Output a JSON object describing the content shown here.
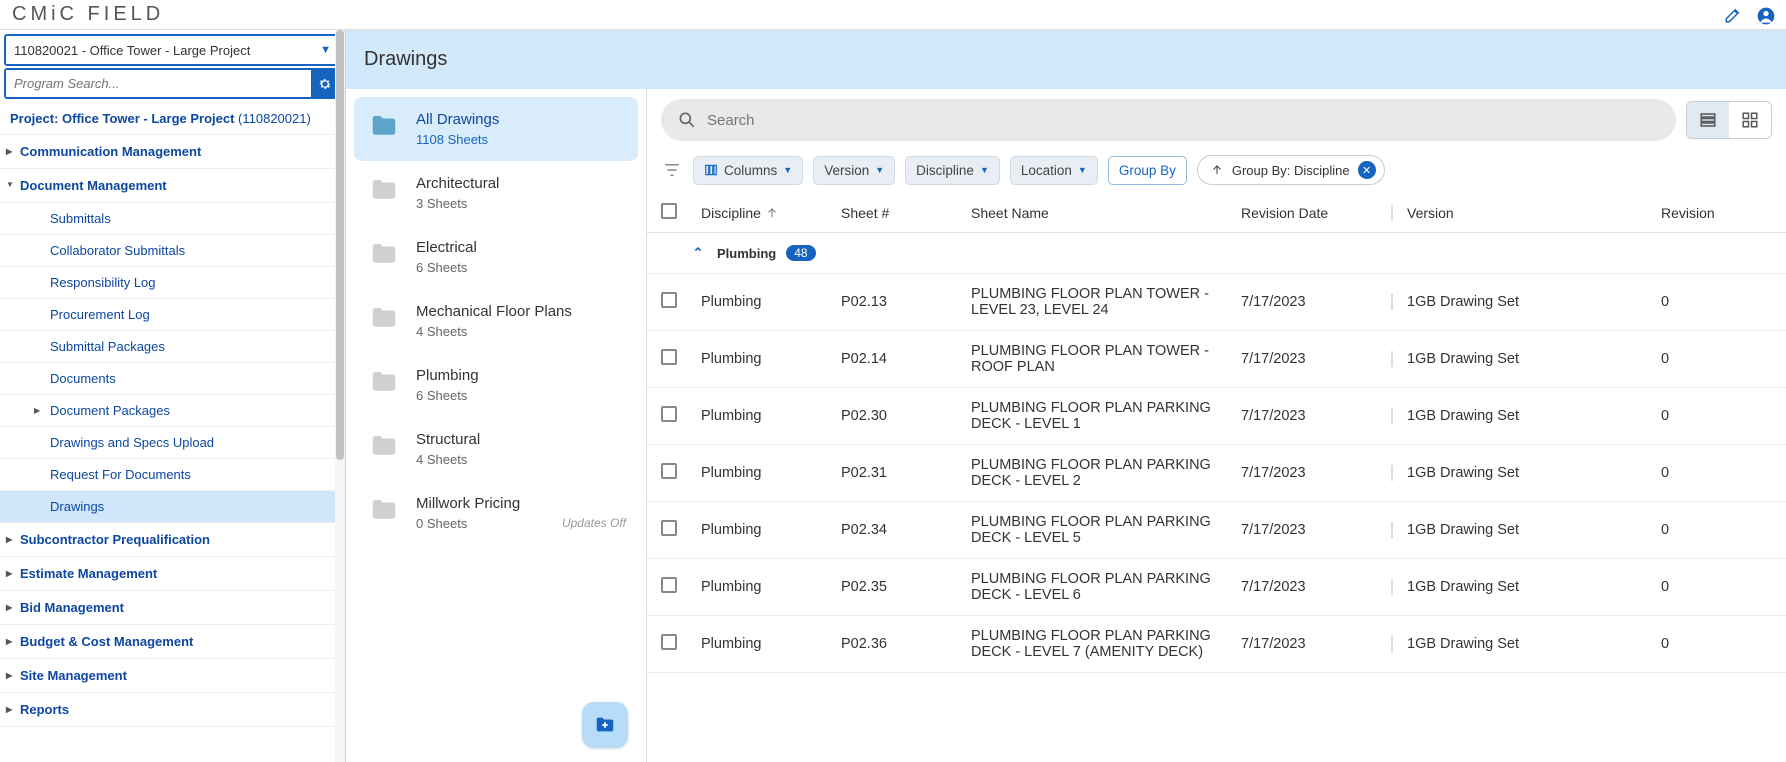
{
  "app": {
    "brand": "CMiC FIELD"
  },
  "project_selector": {
    "value": "110820021 - Office Tower - Large Project"
  },
  "program_search": {
    "placeholder": "Program Search..."
  },
  "project_label": {
    "prefix": "Project: ",
    "name": "Office Tower - Large Project ",
    "code": "(110820021)"
  },
  "nav": {
    "s0": "Communication Management",
    "s1": "Document Management",
    "dm": {
      "i0": "Submittals",
      "i1": "Collaborator Submittals",
      "i2": "Responsibility Log",
      "i3": "Procurement Log",
      "i4": "Submittal Packages",
      "i5": "Documents",
      "i6": "Document Packages",
      "i7": "Drawings and Specs Upload",
      "i8": "Request For Documents",
      "i9": "Drawings"
    },
    "s2": "Subcontractor Prequalification",
    "s3": "Estimate Management",
    "s4": "Bid Management",
    "s5": "Budget & Cost Management",
    "s6": "Site Management",
    "s7": "Reports"
  },
  "page": {
    "title": "Drawings"
  },
  "folders": {
    "f0": {
      "name": "All Drawings",
      "meta": "1108 Sheets"
    },
    "f1": {
      "name": "Architectural",
      "meta": "3 Sheets"
    },
    "f2": {
      "name": "Electrical",
      "meta": "6 Sheets"
    },
    "f3": {
      "name": "Mechanical Floor Plans",
      "meta": "4 Sheets"
    },
    "f4": {
      "name": "Plumbing",
      "meta": "6 Sheets"
    },
    "f5": {
      "name": "Structural",
      "meta": "4 Sheets"
    },
    "f6": {
      "name": "Millwork Pricing",
      "meta": "0 Sheets",
      "meta2": "Updates Off"
    }
  },
  "search": {
    "placeholder": "Search"
  },
  "filters": {
    "columns": "Columns",
    "version": "Version",
    "discipline": "Discipline",
    "location": "Location",
    "groupby": "Group By",
    "chip_label": "Group By: Discipline"
  },
  "table": {
    "h1": "Discipline",
    "h2": "Sheet #",
    "h3": "Sheet Name",
    "h4": "Revision Date",
    "h5": "Version",
    "h6": "Revision",
    "group": {
      "name": "Plumbing",
      "count": "48"
    },
    "rows": [
      {
        "disc": "Plumbing",
        "sheet": "P02.13",
        "name": "PLUMBING FLOOR PLAN TOWER - LEVEL 23, LEVEL 24",
        "date": "7/17/2023",
        "ver": "1GB Drawing Set",
        "rev": "0"
      },
      {
        "disc": "Plumbing",
        "sheet": "P02.14",
        "name": "PLUMBING FLOOR PLAN TOWER - ROOF PLAN",
        "date": "7/17/2023",
        "ver": "1GB Drawing Set",
        "rev": "0"
      },
      {
        "disc": "Plumbing",
        "sheet": "P02.30",
        "name": "PLUMBING FLOOR PLAN PARKING DECK - LEVEL 1",
        "date": "7/17/2023",
        "ver": "1GB Drawing Set",
        "rev": "0"
      },
      {
        "disc": "Plumbing",
        "sheet": "P02.31",
        "name": "PLUMBING FLOOR PLAN PARKING DECK - LEVEL 2",
        "date": "7/17/2023",
        "ver": "1GB Drawing Set",
        "rev": "0"
      },
      {
        "disc": "Plumbing",
        "sheet": "P02.34",
        "name": "PLUMBING FLOOR PLAN PARKING DECK - LEVEL 5",
        "date": "7/17/2023",
        "ver": "1GB Drawing Set",
        "rev": "0"
      },
      {
        "disc": "Plumbing",
        "sheet": "P02.35",
        "name": "PLUMBING FLOOR PLAN PARKING DECK - LEVEL 6",
        "date": "7/17/2023",
        "ver": "1GB Drawing Set",
        "rev": "0"
      },
      {
        "disc": "Plumbing",
        "sheet": "P02.36",
        "name": "PLUMBING FLOOR PLAN PARKING DECK - LEVEL 7 (AMENITY DECK)",
        "date": "7/17/2023",
        "ver": "1GB Drawing Set",
        "rev": "0"
      }
    ]
  }
}
